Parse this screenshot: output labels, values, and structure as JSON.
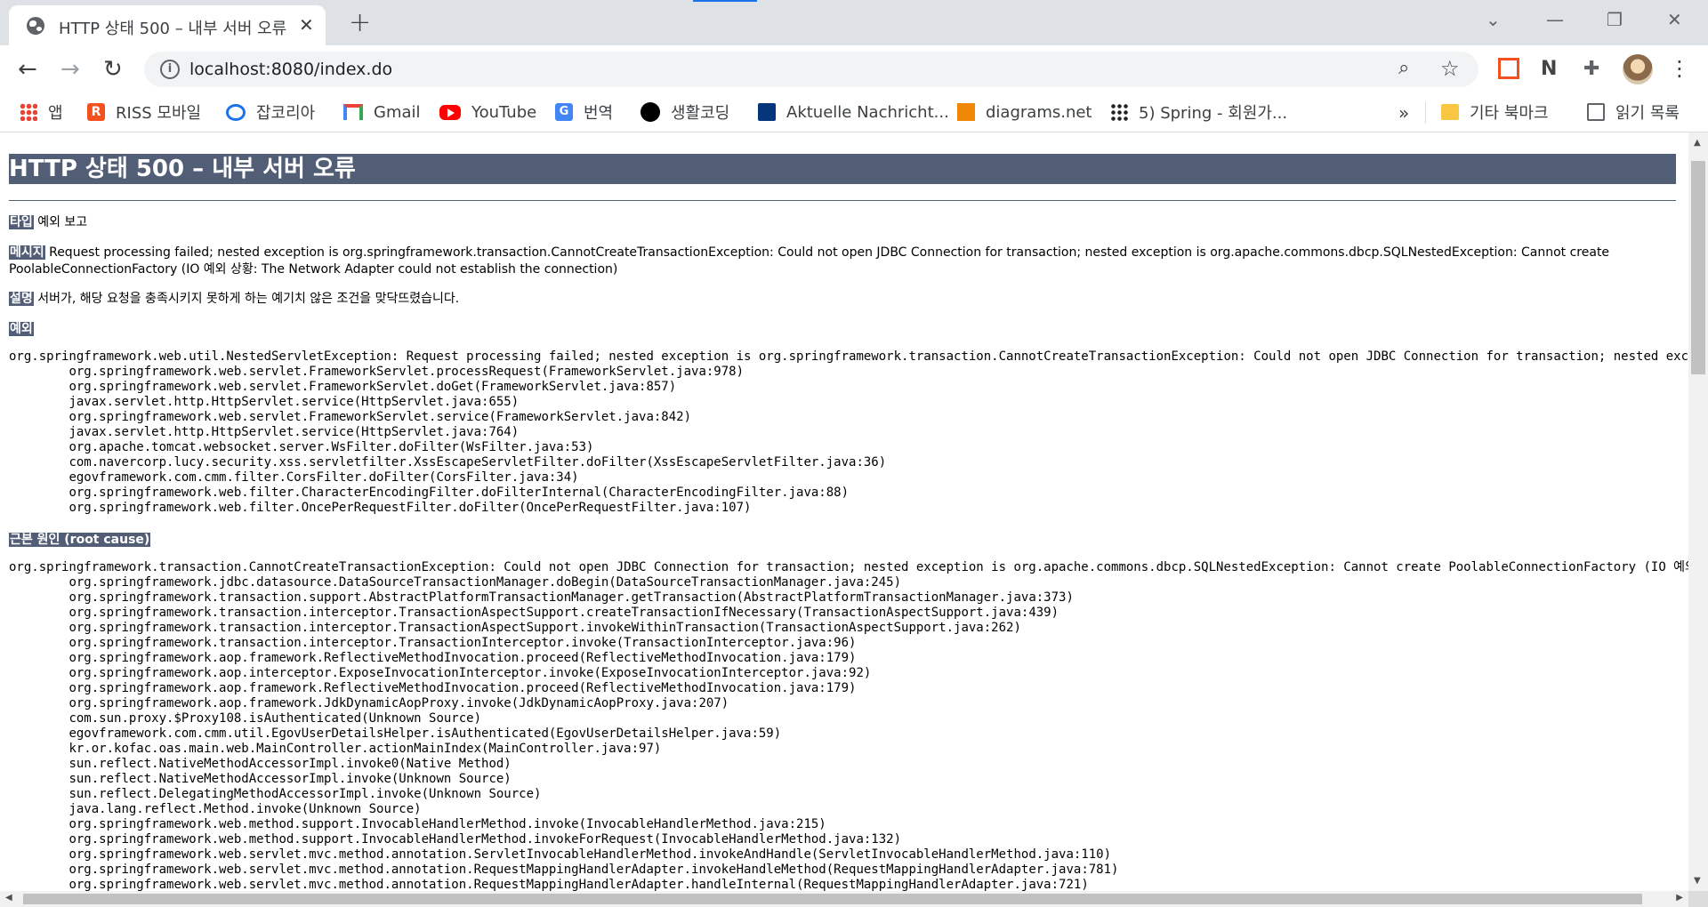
{
  "browser": {
    "tab_title": "HTTP 상태 500 – 내부 서버 오류",
    "url": "localhost:8080/index.do",
    "bookmarks": [
      {
        "label": "앱",
        "icon": "apps-grid-icon"
      },
      {
        "label": "RISS 모바일",
        "icon": "riss-icon"
      },
      {
        "label": "잡코리아",
        "icon": "chat-bubble-icon"
      },
      {
        "label": "Gmail",
        "icon": "gmail-icon"
      },
      {
        "label": "YouTube",
        "icon": "youtube-icon"
      },
      {
        "label": "번역",
        "icon": "translate-icon"
      },
      {
        "label": "생활코딩",
        "icon": "circle-icon"
      },
      {
        "label": "Aktuelle Nachricht...",
        "icon": "dw-icon"
      },
      {
        "label": "diagrams.net",
        "icon": "diagrams-icon"
      },
      {
        "label": "5) Spring - 회원가...",
        "icon": "spring-dots-icon"
      }
    ],
    "more_bookmarks": "»",
    "other_bookmarks": "기타 북마크",
    "reading_list": "읽기 목록"
  },
  "page": {
    "heading": "HTTP 상태 500 – 내부 서버 오류",
    "type_label": "타입",
    "type_value": "예외 보고",
    "message_label": "메시지",
    "message_value": "Request processing failed; nested exception is org.springframework.transaction.CannotCreateTransactionException: Could not open JDBC Connection for transaction; nested exception is org.apache.commons.dbcp.SQLNestedException: Cannot create PoolableConnectionFactory (IO 예외 상황: The Network Adapter could not establish the connection)",
    "description_label": "설명",
    "description_value": "서버가, 해당 요청을 충족시키지 못하게 하는 예기치 않은 조건을 맞닥뜨렸습니다.",
    "exception_label": "예외",
    "exception_trace": "org.springframework.web.util.NestedServletException: Request processing failed; nested exception is org.springframework.transaction.CannotCreateTransactionException: Could not open JDBC Connection for transaction; nested exception is org.apache.commons.dbcp.SQLNestedException: Cannot create PoolableConnectionFactory (IO 예외 상황: The Network Adapter could not establish the connection)\n\torg.springframework.web.servlet.FrameworkServlet.processRequest(FrameworkServlet.java:978)\n\torg.springframework.web.servlet.FrameworkServlet.doGet(FrameworkServlet.java:857)\n\tjavax.servlet.http.HttpServlet.service(HttpServlet.java:655)\n\torg.springframework.web.servlet.FrameworkServlet.service(FrameworkServlet.java:842)\n\tjavax.servlet.http.HttpServlet.service(HttpServlet.java:764)\n\torg.apache.tomcat.websocket.server.WsFilter.doFilter(WsFilter.java:53)\n\tcom.navercorp.lucy.security.xss.servletfilter.XssEscapeServletFilter.doFilter(XssEscapeServletFilter.java:36)\n\tegovframework.com.cmm.filter.CorsFilter.doFilter(CorsFilter.java:34)\n\torg.springframework.web.filter.CharacterEncodingFilter.doFilterInternal(CharacterEncodingFilter.java:88)\n\torg.springframework.web.filter.OncePerRequestFilter.doFilter(OncePerRequestFilter.java:107)",
    "root_cause_label": "근본 원인 (root cause)",
    "root_cause_trace": "org.springframework.transaction.CannotCreateTransactionException: Could not open JDBC Connection for transaction; nested exception is org.apache.commons.dbcp.SQLNestedException: Cannot create PoolableConnectionFactory (IO 예외 상황: The Network Adapter could not establish the connection)\n\torg.springframework.jdbc.datasource.DataSourceTransactionManager.doBegin(DataSourceTransactionManager.java:245)\n\torg.springframework.transaction.support.AbstractPlatformTransactionManager.getTransaction(AbstractPlatformTransactionManager.java:373)\n\torg.springframework.transaction.interceptor.TransactionAspectSupport.createTransactionIfNecessary(TransactionAspectSupport.java:439)\n\torg.springframework.transaction.interceptor.TransactionAspectSupport.invokeWithinTransaction(TransactionAspectSupport.java:262)\n\torg.springframework.transaction.interceptor.TransactionInterceptor.invoke(TransactionInterceptor.java:96)\n\torg.springframework.aop.framework.ReflectiveMethodInvocation.proceed(ReflectiveMethodInvocation.java:179)\n\torg.springframework.aop.interceptor.ExposeInvocationInterceptor.invoke(ExposeInvocationInterceptor.java:92)\n\torg.springframework.aop.framework.ReflectiveMethodInvocation.proceed(ReflectiveMethodInvocation.java:179)\n\torg.springframework.aop.framework.JdkDynamicAopProxy.invoke(JdkDynamicAopProxy.java:207)\n\tcom.sun.proxy.$Proxy108.isAuthenticated(Unknown Source)\n\tegovframework.com.cmm.util.EgovUserDetailsHelper.isAuthenticated(EgovUserDetailsHelper.java:59)\n\tkr.or.kofac.oas.main.web.MainController.actionMainIndex(MainController.java:97)\n\tsun.reflect.NativeMethodAccessorImpl.invoke0(Native Method)\n\tsun.reflect.NativeMethodAccessorImpl.invoke(Unknown Source)\n\tsun.reflect.DelegatingMethodAccessorImpl.invoke(Unknown Source)\n\tjava.lang.reflect.Method.invoke(Unknown Source)\n\torg.springframework.web.method.support.InvocableHandlerMethod.invoke(InvocableHandlerMethod.java:215)\n\torg.springframework.web.method.support.InvocableHandlerMethod.invokeForRequest(InvocableHandlerMethod.java:132)\n\torg.springframework.web.servlet.mvc.method.annotation.ServletInvocableHandlerMethod.invokeAndHandle(ServletInvocableHandlerMethod.java:110)\n\torg.springframework.web.servlet.mvc.method.annotation.RequestMappingHandlerAdapter.invokeHandleMethod(RequestMappingHandlerAdapter.java:781)\n\torg.springframework.web.servlet.mvc.method.annotation.RequestMappingHandlerAdapter.handleInternal(RequestMappingHandlerAdapter.java:721)"
  },
  "colors": {
    "heading_bg": "#525d76",
    "tabstrip_bg": "#dee1e6"
  }
}
